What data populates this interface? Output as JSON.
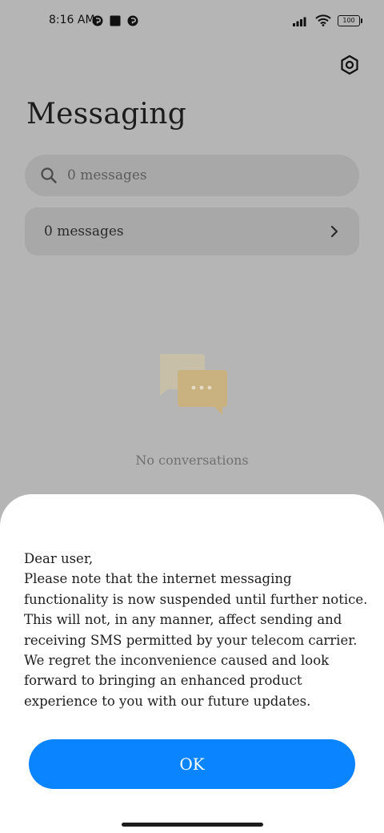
{
  "status_bar": {
    "time": "8:16 AM",
    "left_icons": [
      "notification-app-icon",
      "stop-square-icon",
      "notification-app-icon"
    ],
    "right_icons": [
      "signal-icon",
      "wifi-icon",
      "battery-icon"
    ],
    "battery_level": "100"
  },
  "header": {
    "title": "Messaging",
    "settings_icon": "gear-icon"
  },
  "search": {
    "placeholder": "0 messages",
    "icon": "search-icon"
  },
  "messages_row": {
    "label": "0 messages",
    "icon": "chevron-right-icon"
  },
  "empty_state": {
    "icon": "chat-bubbles-icon",
    "text": "No conversations"
  },
  "dialog": {
    "greeting": "Dear user,",
    "body": "Please note that the internet messaging functionality is now suspended until further notice. This will not, in any manner, affect sending and receiving SMS permitted by your telecom carrier. We regret the inconvenience caused and look forward to bringing an enhanced product experience to you with our future updates.",
    "ok_label": "OK"
  },
  "colors": {
    "backdrop": "#b5b5b5",
    "accent": "#0a84ff",
    "sheet": "#ffffff",
    "illustration_back": "#d8d0b7",
    "illustration_front": "#e2c27e"
  }
}
